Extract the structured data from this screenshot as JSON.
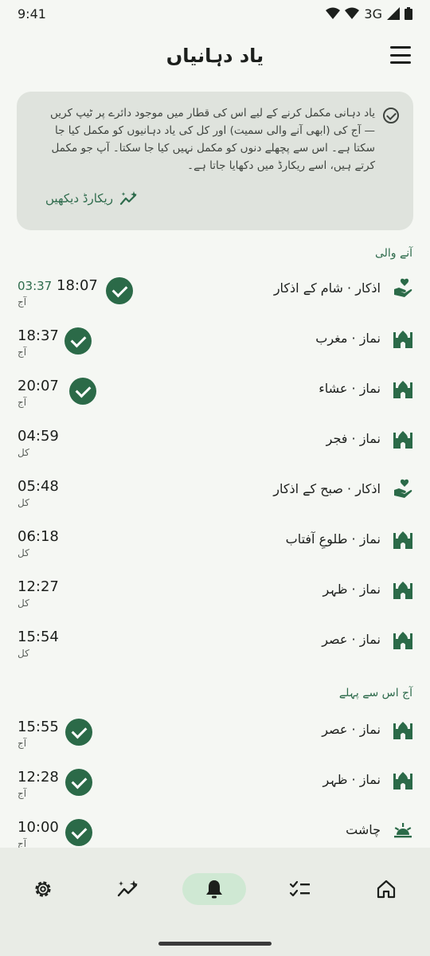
{
  "status": {
    "time": "9:41",
    "network": "3G"
  },
  "appbar": {
    "title": "یاد دہانیاں",
    "menu_icon": "hamburger-menu-icon"
  },
  "info": {
    "text": "یاد دہانی مکمل کرنے کے لیے اس کی قطار میں موجود دائرے پر ٹیپ کریں — آج کی (ابھی آنے والی سمیت) اور کل کی یاد دہانیوں کو مکمل کیا جا سکتا ہے۔ اس سے پچھلے دنوں کو مکمل نہیں کیا جا سکتا۔ آپ جو مکمل کرتے ہیں، اسے ریکارڈ میں دکھایا جاتا ہے۔",
    "link": "ریکارڈ دیکھیں"
  },
  "sections": {
    "upcoming": "آنے والی",
    "earlier": "آج اس سے پہلے"
  },
  "upcoming_items": [
    {
      "time": "18:07",
      "orig_time": "03:37",
      "day": "آج",
      "label": "اذکار · شام کے اذکار",
      "icon": "dhikr-hand-heart-icon",
      "done": true
    },
    {
      "time": "18:37",
      "day": "آج",
      "label": "نماز · مغرب",
      "icon": "mosque-icon",
      "done": true
    },
    {
      "time": "20:07",
      "day": "آج",
      "label": "نماز · عشاء",
      "icon": "mosque-icon",
      "done": true
    },
    {
      "time": "04:59",
      "day": "کل",
      "label": "نماز · فجر",
      "icon": "mosque-icon",
      "done": false
    },
    {
      "time": "05:48",
      "day": "کل",
      "label": "اذکار · صبح کے اذکار",
      "icon": "dhikr-hand-heart-icon",
      "done": false
    },
    {
      "time": "06:18",
      "day": "کل",
      "label": "نماز · طلوعِ آفتاب",
      "icon": "mosque-icon",
      "done": false
    },
    {
      "time": "12:27",
      "day": "کل",
      "label": "نماز · ظہر",
      "icon": "mosque-icon",
      "done": false
    },
    {
      "time": "15:54",
      "day": "کل",
      "label": "نماز · عصر",
      "icon": "mosque-icon",
      "done": false
    }
  ],
  "earlier_items": [
    {
      "time": "15:55",
      "day": "آج",
      "label": "نماز · عصر",
      "icon": "mosque-icon",
      "done": true
    },
    {
      "time": "12:28",
      "day": "آج",
      "label": "نماز · ظہر",
      "icon": "mosque-icon",
      "done": true
    },
    {
      "time": "10:00",
      "day": "آج",
      "label": "چاشت",
      "icon": "sunrise-icon",
      "done": true
    }
  ],
  "nav": [
    {
      "name": "settings",
      "icon": "gear-icon"
    },
    {
      "name": "records",
      "icon": "sparkle-chart-icon"
    },
    {
      "name": "reminders",
      "icon": "bell-icon",
      "active": true
    },
    {
      "name": "tasks",
      "icon": "checklist-icon"
    },
    {
      "name": "home",
      "icon": "home-icon"
    }
  ],
  "colors": {
    "accent": "#2b6a48",
    "active_pill": "#cfe8d3",
    "card": "#dfe3dd"
  }
}
